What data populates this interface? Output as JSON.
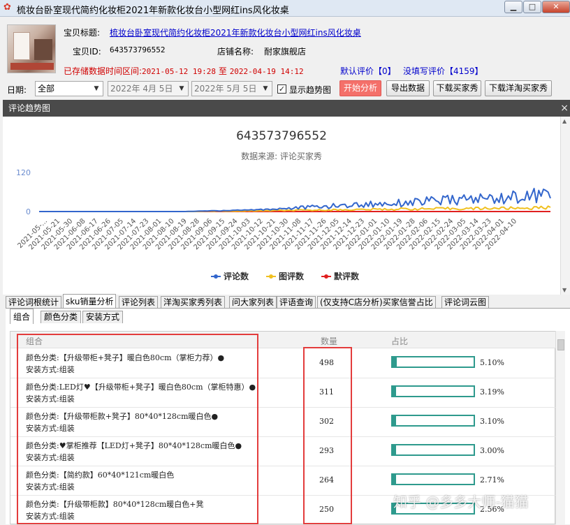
{
  "window": {
    "title": "梳妆台卧室现代简约化妆柜2021年新款化妆台小型网红ins风化妆桌",
    "min_icon": "minimize-icon",
    "max_icon": "maximize-icon",
    "close_icon": "close-icon"
  },
  "product": {
    "title_label": "宝贝标题:",
    "title_value": "梳妆台卧室现代简约化妆柜2021年新款化妆台小型网红ins风化妆桌",
    "id_label": "宝贝ID:",
    "id_value": "643573796552",
    "shop_label": "店铺名称:",
    "shop_value": "耐家旗舰店",
    "range_prefix": "已存储数据时间区间:",
    "range_start": "2021-05-12 19:28",
    "range_to": "至",
    "range_end": "2022-04-19 14:12",
    "default_review_label": "默认评价【0】",
    "no_review_label": "没填写评价【4159】"
  },
  "toolbar": {
    "date_label": "日期:",
    "date_option": "全部",
    "date_from": "2022年 4月 5日",
    "date_to": "2022年 5月 5日",
    "show_trend_label": "显示趋势图",
    "show_trend_checked": true,
    "start_button": "开始分析",
    "export_button": "导出数据",
    "download_buyer_button": "下载买家秀",
    "download_yangtao_button": "下载洋淘买家秀"
  },
  "trend_panel": {
    "header": "评论趋势图",
    "close_symbol": "×"
  },
  "chart_data": {
    "type": "line",
    "title": "643573796552",
    "subtitle": "数据来源: 评论买家秀",
    "y_ticks": [
      "120",
      "0"
    ],
    "ylim": [
      0,
      120
    ],
    "x_tick_labels": [
      "2021-05-...",
      "2021-05-21",
      "2021-05-30",
      "2021-06-08",
      "2021-06-17",
      "2021-06-26",
      "2021-07-05",
      "2021-07-14",
      "2021-07-23",
      "2021-08-01",
      "2021-08-10",
      "2021-08-19",
      "2021-08-28",
      "2021-09-06",
      "2021-09-15",
      "2021-09-24",
      "2021-10-03",
      "2021-10-12",
      "2021-10-21",
      "2021-10-30",
      "2021-11-08",
      "2021-11-17",
      "2021-11-26",
      "2021-12-05",
      "2021-12-14",
      "2021-12-23",
      "2022-01-01",
      "2022-01-10",
      "2022-01-19",
      "2022-01-28",
      "2022-02-06",
      "2022-02-15",
      "2022-02-24",
      "2022-03-05",
      "2022-03-14",
      "2022-03-23",
      "2022-04-01",
      "2022-04-10"
    ],
    "series": [
      {
        "name": "评论数",
        "color": "#3366cc",
        "values": [
          0,
          0,
          0,
          0,
          0,
          0,
          0,
          0,
          0,
          0,
          0,
          0,
          1,
          2,
          3,
          4,
          5,
          6,
          8,
          10,
          12,
          14,
          16,
          18,
          20,
          22,
          24,
          26,
          28,
          30,
          32,
          34,
          36,
          38,
          40,
          42,
          44,
          46,
          50,
          52
        ]
      },
      {
        "name": "图评数",
        "color": "#f0c020",
        "values": [
          0,
          0,
          0,
          0,
          0,
          0,
          0,
          0,
          0,
          0,
          0,
          0,
          0,
          1,
          1,
          1,
          2,
          2,
          3,
          3,
          4,
          4,
          5,
          5,
          6,
          6,
          7,
          7,
          8,
          8,
          8,
          9,
          9,
          9,
          10,
          10,
          10,
          11,
          11,
          12
        ]
      },
      {
        "name": "默评数",
        "color": "#e02020",
        "values": [
          0,
          0,
          0,
          0,
          0,
          0,
          0,
          0,
          0,
          0,
          0,
          0,
          0,
          0,
          0,
          0,
          0,
          0,
          0,
          0,
          0,
          0,
          0,
          0,
          0,
          0,
          0,
          0,
          0,
          0,
          0,
          0,
          0,
          0,
          0,
          0,
          0,
          0,
          0,
          0
        ]
      }
    ],
    "legend_position": "bottom-center"
  },
  "tabs": [
    "评论词根统计",
    "sku销量分析",
    "评论列表",
    "洋淘买家秀列表",
    "问大家列表",
    "评语查询",
    "(仅支持C店分析)买家信誉占比",
    "评论词云图"
  ],
  "active_tab": 1,
  "subtabs": [
    "组合",
    "颜色分类",
    "安装方式"
  ],
  "active_subtab": 0,
  "table": {
    "headers": [
      "组合",
      "数量",
      "占比"
    ],
    "rows": [
      {
        "line1": "颜色分类:【升级带柜+凳子】暖白色80cm（掌柜力荐）●",
        "line2": "安装方式:组装",
        "count": "498",
        "pct": "5.10%",
        "ratio": 0.051
      },
      {
        "line1": "颜色分类:LED灯♥【升级带柜+凳子】暖白色80cm（掌柜特惠）●",
        "line2": "安装方式:组装",
        "count": "311",
        "pct": "3.19%",
        "ratio": 0.0319
      },
      {
        "line1": "颜色分类:【升级带柜款+凳子】80*40*128cm暖白色●",
        "line2": "安装方式:组装",
        "count": "302",
        "pct": "3.10%",
        "ratio": 0.031
      },
      {
        "line1": "颜色分类:♥掌柜推荐【LED灯+凳子】80*40*128cm暖白色●",
        "line2": "安装方式:组装",
        "count": "293",
        "pct": "3.00%",
        "ratio": 0.03
      },
      {
        "line1": "颜色分类:【简约款】60*40*121cm暖白色",
        "line2": "安装方式:组装",
        "count": "264",
        "pct": "2.71%",
        "ratio": 0.0271
      },
      {
        "line1": "颜色分类:【升级带柜款】80*40*128cm暖白色+凳",
        "line2": "安装方式:组装",
        "count": "250",
        "pct": "2.56%",
        "ratio": 0.0256
      }
    ]
  },
  "watermark": "知乎 @多多大师-猫猫"
}
